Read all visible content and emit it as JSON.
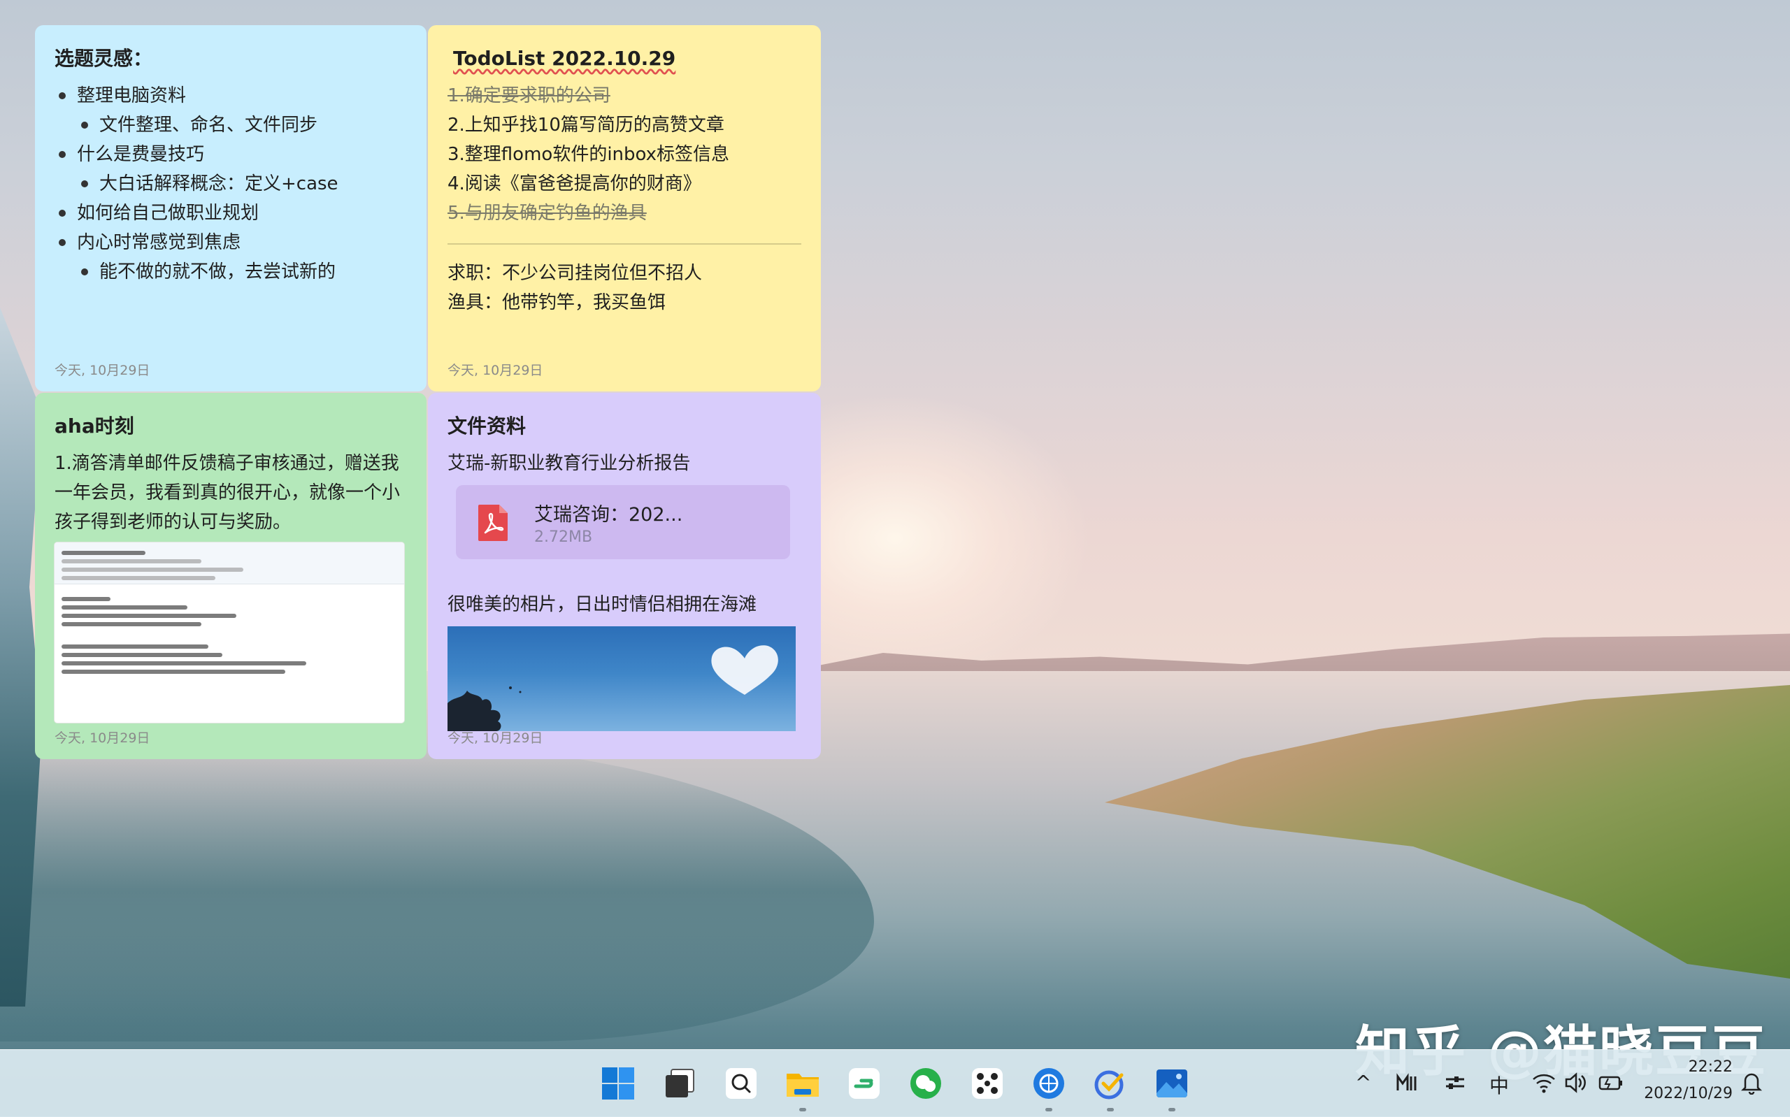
{
  "notes": {
    "blue": {
      "title": "选题灵感：",
      "items": [
        "整理电脑资料",
        "文件整理、命名、文件同步",
        "什么是费曼技巧",
        "大白话解释概念：定义+case",
        "如何给自己做职业规划",
        "内心时常感觉到焦虑",
        "能不做的就不做，去尝试新的"
      ],
      "date": "今天, 10月29日"
    },
    "yellow": {
      "title": "TodoList 2022.10.29",
      "todos": [
        "1.确定要求职的公司",
        "2.上知乎找10篇写简历的高赞文章",
        "3.整理flomo软件的inbox标签信息",
        "4.阅读《富爸爸提高你的财商》",
        "5.与朋友确定钓鱼的渔具"
      ],
      "notes": [
        "求职：不少公司挂岗位但不招人",
        "渔具：他带钓竿，我买鱼饵"
      ],
      "date": "今天, 10月29日"
    },
    "green": {
      "title": "aha时刻",
      "body": "1.滴答清单邮件反馈稿子审核通过，赠送我一年会员，我看到真的很开心，就像一个小孩子得到老师的认可与奖励。",
      "date": "今天, 10月29日"
    },
    "purple": {
      "title": "文件资料",
      "report_label": "艾瑞-新职业教育行业分析报告",
      "file_name": "艾瑞咨询：202...",
      "file_size": "2.72MB",
      "photo_caption": "很唯美的相片，日出时情侣相拥在海滩",
      "date": "今天, 10月29日"
    }
  },
  "taskbar": {
    "apps": [
      "start-icon",
      "task-view-icon",
      "search-icon",
      "file-explorer-icon",
      "flomo-icon",
      "wechat-icon",
      "app-nodes-icon",
      "browser-icon",
      "ticktick-icon",
      "photos-icon"
    ],
    "tray": {
      "chevron": "^",
      "ime": "中",
      "time": "22:22",
      "date": "2022/10/29"
    }
  },
  "watermark": "知乎 @猫晓豆豆",
  "colors": {
    "note_blue": "#c8eefe",
    "note_yellow": "#fff1a6",
    "note_green": "#b4e8ba",
    "note_purple": "#d8ccfb"
  }
}
